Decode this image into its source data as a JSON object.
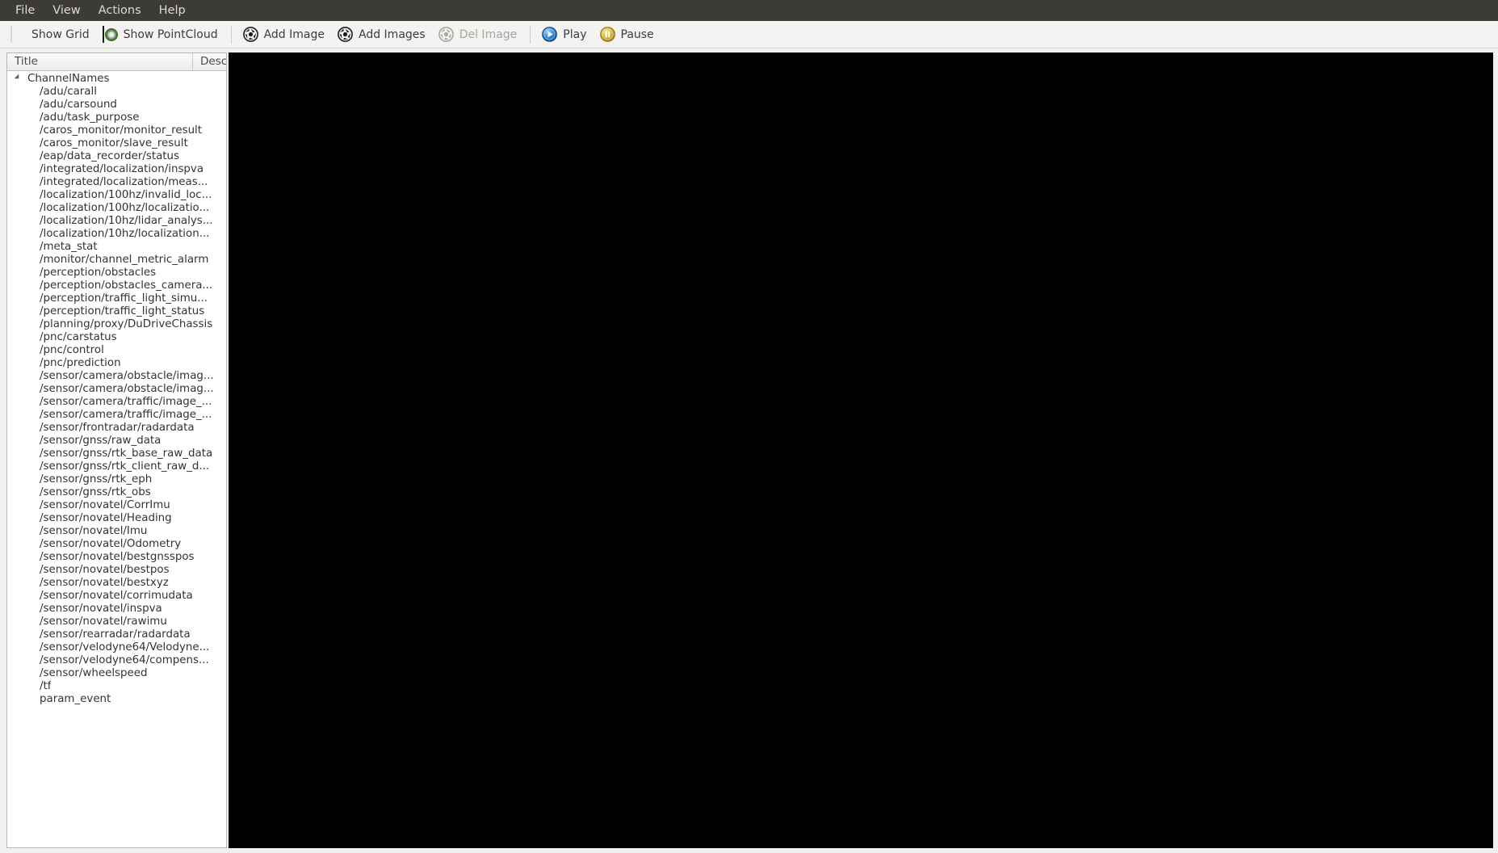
{
  "menubar": {
    "items": [
      {
        "label": "File",
        "name": "menu-file"
      },
      {
        "label": "View",
        "name": "menu-view"
      },
      {
        "label": "Actions",
        "name": "menu-actions"
      },
      {
        "label": "Help",
        "name": "menu-help"
      }
    ]
  },
  "toolbar": {
    "show_grid": {
      "label": "Show Grid",
      "icon": "grid-icon",
      "enabled": true
    },
    "show_pointcloud": {
      "label": "Show PointCloud",
      "icon": "pointcloud-icon",
      "enabled": true
    },
    "add_image": {
      "label": "Add Image",
      "icon": "aperture-icon",
      "enabled": true
    },
    "add_images": {
      "label": "Add Images",
      "icon": "aperture-icon",
      "enabled": true
    },
    "del_image": {
      "label": "Del Image",
      "icon": "aperture-icon",
      "enabled": false
    },
    "play": {
      "label": "Play",
      "icon": "play-icon",
      "enabled": true
    },
    "pause": {
      "label": "Pause",
      "icon": "pause-icon",
      "enabled": true
    }
  },
  "tree": {
    "columns": {
      "title": "Title",
      "description": "Descri"
    },
    "root": {
      "label": "ChannelNames",
      "expanded": true
    },
    "channels": [
      "/adu/carall",
      "/adu/carsound",
      "/adu/task_purpose",
      "/caros_monitor/monitor_result",
      "/caros_monitor/slave_result",
      "/eap/data_recorder/status",
      "/integrated/localization/inspva",
      "/integrated/localization/meas...",
      "/localization/100hz/invalid_loc...",
      "/localization/100hz/localizatio...",
      "/localization/10hz/lidar_analys...",
      "/localization/10hz/localization...",
      "/meta_stat",
      "/monitor/channel_metric_alarm",
      "/perception/obstacles",
      "/perception/obstacles_camera...",
      "/perception/traffic_light_simu...",
      "/perception/traffic_light_status",
      "/planning/proxy/DuDriveChassis",
      "/pnc/carstatus",
      "/pnc/control",
      "/pnc/prediction",
      "/sensor/camera/obstacle/imag...",
      "/sensor/camera/obstacle/imag...",
      "/sensor/camera/traffic/image_...",
      "/sensor/camera/traffic/image_...",
      "/sensor/frontradar/radardata",
      "/sensor/gnss/raw_data",
      "/sensor/gnss/rtk_base_raw_data",
      "/sensor/gnss/rtk_client_raw_d...",
      "/sensor/gnss/rtk_eph",
      "/sensor/gnss/rtk_obs",
      "/sensor/novatel/CorrImu",
      "/sensor/novatel/Heading",
      "/sensor/novatel/Imu",
      "/sensor/novatel/Odometry",
      "/sensor/novatel/bestgnsspos",
      "/sensor/novatel/bestpos",
      "/sensor/novatel/bestxyz",
      "/sensor/novatel/corrimudata",
      "/sensor/novatel/inspva",
      "/sensor/novatel/rawimu",
      "/sensor/rearradar/radardata",
      "/sensor/velodyne64/Velodyne...",
      "/sensor/velodyne64/compens...",
      "/sensor/wheelspeed",
      "/tf",
      "param_event"
    ]
  },
  "viewport": {
    "name": "render-viewport",
    "background": "#000000"
  },
  "colors": {
    "menubar_bg": "#3c3b37",
    "menubar_text": "#dfdbd2",
    "toolbar_bg": "#f4f3f2",
    "window_bg": "#f2f1f0",
    "tree_bg": "#ffffff",
    "tree_text": "#2e3436",
    "disabled_text": "#a6a39f",
    "play_accent": "#2f7fd0",
    "pause_accent": "#d8b735"
  }
}
